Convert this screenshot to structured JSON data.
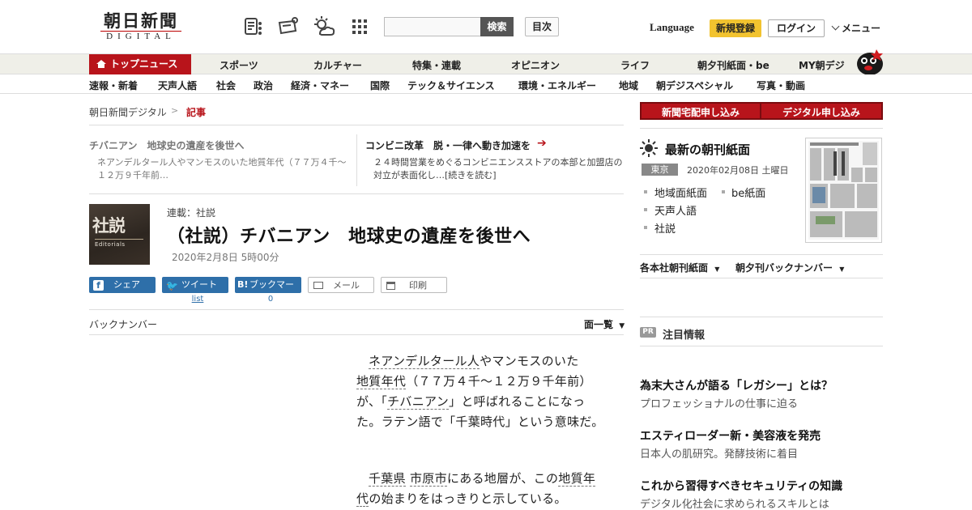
{
  "header": {
    "logo_main": "朝日新聞",
    "logo_sub": "DIGITAL",
    "search_button": "検索",
    "toc_button": "目次",
    "language": "Language",
    "signup": "新規登録",
    "login": "ログイン",
    "menu": "メニュー"
  },
  "nav_primary": [
    "トップニュース",
    "スポーツ",
    "カルチャー",
    "特集・連載",
    "オピニオン",
    "ライフ",
    "朝夕刊紙面・be",
    "MY朝デジ"
  ],
  "nav_secondary": [
    "速報・新着",
    "天声人語",
    "社会",
    "政治",
    "経済・マネー",
    "国際",
    "テック＆サイエンス",
    "環境・エネルギー",
    "地域",
    "朝デジスペシャル",
    "写真・動画"
  ],
  "breadcrumb": {
    "home": "朝日新聞デジタル",
    "sep": ">",
    "current": "記事"
  },
  "related": [
    {
      "title": "チバニアン　地球史の遺産を後世へ",
      "body": "ネアンデルタール人やマンモスのいた地質年代（７７万４千～１２万９千年前…"
    },
    {
      "title": "コンビニ改革　脱・一律へ動き加速を",
      "body": "２４時間営業をめぐるコンビニエンスストアの本部と加盟店の対立が表面化し…[続きを読む]"
    }
  ],
  "article": {
    "thumb_kanji": "社説",
    "thumb_en": "Editorials",
    "series": "連載：社説",
    "headline": "（社説）チバニアン　地球史の遺産を後世へ",
    "date": "2020年2月8日 5時00分",
    "paragraph1": [
      "ネアンデルタール人",
      "やマンモスのいた",
      "地質年代",
      "（７７万４千～１２万９千年前）が、「",
      "チバニアン",
      "」と呼ばれることになった。ラテン語で「千葉時代」という意味だ。"
    ],
    "paragraph2": [
      "千葉県",
      "市原市",
      "にある地層が、この",
      "地質年代",
      "の始まりをはっきりと示している。"
    ]
  },
  "share": {
    "facebook": "シェア",
    "twitter": "ツイート",
    "twitter_sub": "list",
    "hatena": "ブックマーク",
    "hatena_badge": "B!",
    "hatena_count": "0",
    "mail": "メール",
    "print": "印刷"
  },
  "backnumber": {
    "label": "バックナンバー",
    "list": "面一覧"
  },
  "sidebar": {
    "subscribe_home": "新聞宅配申し込み",
    "subscribe_digital": "デジタル申し込み",
    "paper_title": "最新の朝刊紙面",
    "paper_edition": "東京",
    "paper_date": "2020年02月08日 土曜日",
    "paper_links": [
      "地域面紙面",
      "be紙面",
      "天声人語",
      "社説"
    ],
    "dropdown_1": "各本社朝刊紙面",
    "dropdown_2": "朝夕刊バックナンバー",
    "pr_badge": "PR",
    "pr_title": "注目情報",
    "pr_items": [
      {
        "title": "為末大さんが語る「レガシー」とは？",
        "sub": "プロフェッショナルの仕事に迫る"
      },
      {
        "title": "エスティローダー新・美容液を発売",
        "sub": "日本人の肌研究。発酵技術に着目"
      },
      {
        "title": "これから習得すべきセキュリティの知識",
        "sub": "デジタル化社会に求められるスキルとは"
      }
    ]
  },
  "colors": {
    "brand_red": "#b8141b",
    "share_blue": "#2e6fa9",
    "signup_yellow": "#f2c32f"
  }
}
